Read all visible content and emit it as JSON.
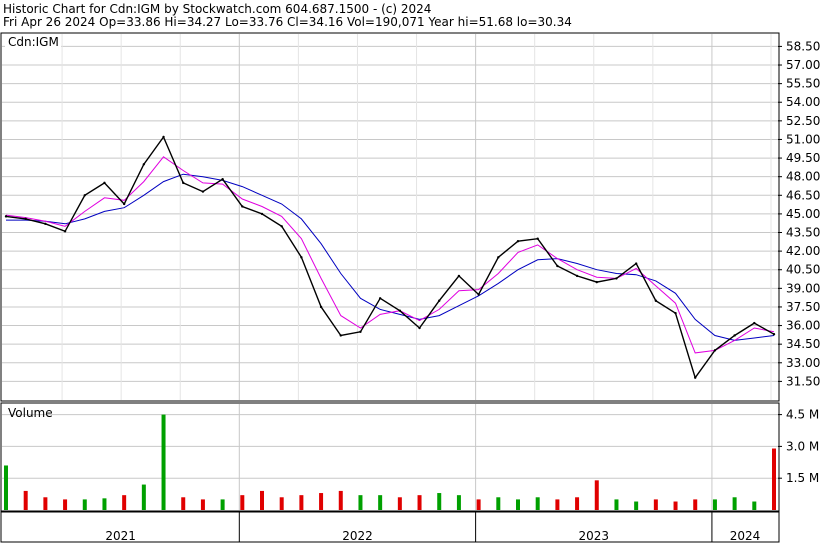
{
  "header": {
    "line1": "Historic Chart for Cdn:IGM by Stockwatch.com 604.687.1500 - (c) 2024",
    "line2": "Fri Apr 26 2024   Op=33.86   Hi=34.27   Lo=33.76   Cl=34.16   Vol=190,071   Year hi=51.68   lo=30.34"
  },
  "price_panel": {
    "symbol_label": "Cdn:IGM"
  },
  "volume_panel": {
    "label": "Volume"
  },
  "colors": {
    "price": "#000000",
    "ma_short": "#e000e0",
    "ma_long": "#0000c0",
    "vol_up": "#00a000",
    "vol_down": "#e00000",
    "grid": "#c8c8c8"
  },
  "chart_data": [
    {
      "type": "line",
      "title": "",
      "ylabel": "",
      "ylim": [
        30.0,
        59.5
      ],
      "yticks": [
        "58.50",
        "57.00",
        "55.50",
        "54.00",
        "52.50",
        "51.00",
        "49.50",
        "48.00",
        "46.50",
        "45.00",
        "43.50",
        "42.00",
        "40.50",
        "39.00",
        "37.50",
        "36.00",
        "34.50",
        "33.00",
        "31.50"
      ],
      "x": [
        "2021-01",
        "2021-02",
        "2021-03",
        "2021-04",
        "2021-05",
        "2021-06",
        "2021-07",
        "2021-08",
        "2021-09",
        "2021-10",
        "2021-11",
        "2021-12",
        "2022-01",
        "2022-02",
        "2022-03",
        "2022-04",
        "2022-05",
        "2022-06",
        "2022-07",
        "2022-08",
        "2022-09",
        "2022-10",
        "2022-11",
        "2022-12",
        "2023-01",
        "2023-02",
        "2023-03",
        "2023-04",
        "2023-05",
        "2023-06",
        "2023-07",
        "2023-08",
        "2023-09",
        "2023-10",
        "2023-11",
        "2023-12",
        "2024-01",
        "2024-02",
        "2024-03",
        "2024-04"
      ],
      "series": [
        {
          "values": [
            44.8,
            44.6,
            44.2,
            43.6,
            46.5,
            47.5,
            45.8,
            49.0,
            51.2,
            47.5,
            46.8,
            47.8,
            45.6,
            45.0,
            44.0,
            41.5,
            37.5,
            35.2,
            35.5,
            38.2,
            37.2,
            35.8,
            38.0,
            40.0,
            38.5,
            41.5,
            42.8,
            43.0,
            40.8,
            40.0,
            39.5,
            39.8,
            41.0,
            38.0,
            37.0,
            31.8,
            34.0,
            35.2,
            36.2,
            35.3
          ]
        },
        {
          "values": [
            44.9,
            44.7,
            44.4,
            44.0,
            45.2,
            46.3,
            46.1,
            47.6,
            49.6,
            48.5,
            47.5,
            47.4,
            46.2,
            45.6,
            44.8,
            43.0,
            39.8,
            36.8,
            35.8,
            36.9,
            37.2,
            36.4,
            37.3,
            38.8,
            38.9,
            40.2,
            41.9,
            42.5,
            41.4,
            40.5,
            39.9,
            39.8,
            40.6,
            39.2,
            37.8,
            33.8,
            34.0,
            34.8,
            35.8,
            35.5
          ]
        },
        {
          "values": [
            44.5,
            44.5,
            44.4,
            44.2,
            44.6,
            45.2,
            45.5,
            46.5,
            47.6,
            48.2,
            48.0,
            47.7,
            47.2,
            46.5,
            45.8,
            44.6,
            42.6,
            40.2,
            38.2,
            37.3,
            36.9,
            36.5,
            36.8,
            37.6,
            38.4,
            39.4,
            40.5,
            41.3,
            41.4,
            41.0,
            40.5,
            40.2,
            40.1,
            39.6,
            38.6,
            36.5,
            35.2,
            34.8,
            35.0,
            35.2
          ]
        }
      ]
    },
    {
      "type": "bar",
      "title": "",
      "ylabel": "Volume",
      "ylim": [
        0,
        5000000
      ],
      "yticks": [
        "4.5 M",
        "3.0 M",
        "1.5 M"
      ],
      "x": [
        "2021-01",
        "2021-02",
        "2021-03",
        "2021-04",
        "2021-05",
        "2021-06",
        "2021-07",
        "2021-08",
        "2021-09",
        "2021-10",
        "2021-11",
        "2021-12",
        "2022-01",
        "2022-02",
        "2022-03",
        "2022-04",
        "2022-05",
        "2022-06",
        "2022-07",
        "2022-08",
        "2022-09",
        "2022-10",
        "2022-11",
        "2022-12",
        "2023-01",
        "2023-02",
        "2023-03",
        "2023-04",
        "2023-05",
        "2023-06",
        "2023-07",
        "2023-08",
        "2023-09",
        "2023-10",
        "2023-11",
        "2023-12",
        "2024-01",
        "2024-02",
        "2024-03",
        "2024-04"
      ],
      "values": [
        2100000,
        900000,
        600000,
        500000,
        500000,
        550000,
        700000,
        1200000,
        4500000,
        600000,
        500000,
        500000,
        700000,
        900000,
        600000,
        700000,
        800000,
        900000,
        700000,
        700000,
        600000,
        700000,
        800000,
        700000,
        500000,
        600000,
        500000,
        600000,
        500000,
        600000,
        1400000,
        500000,
        400000,
        500000,
        400000,
        500000,
        500000,
        600000,
        400000,
        2900000
      ]
    }
  ],
  "x_axis": {
    "year_labels": [
      "2021",
      "2022",
      "2023",
      "2024"
    ]
  }
}
